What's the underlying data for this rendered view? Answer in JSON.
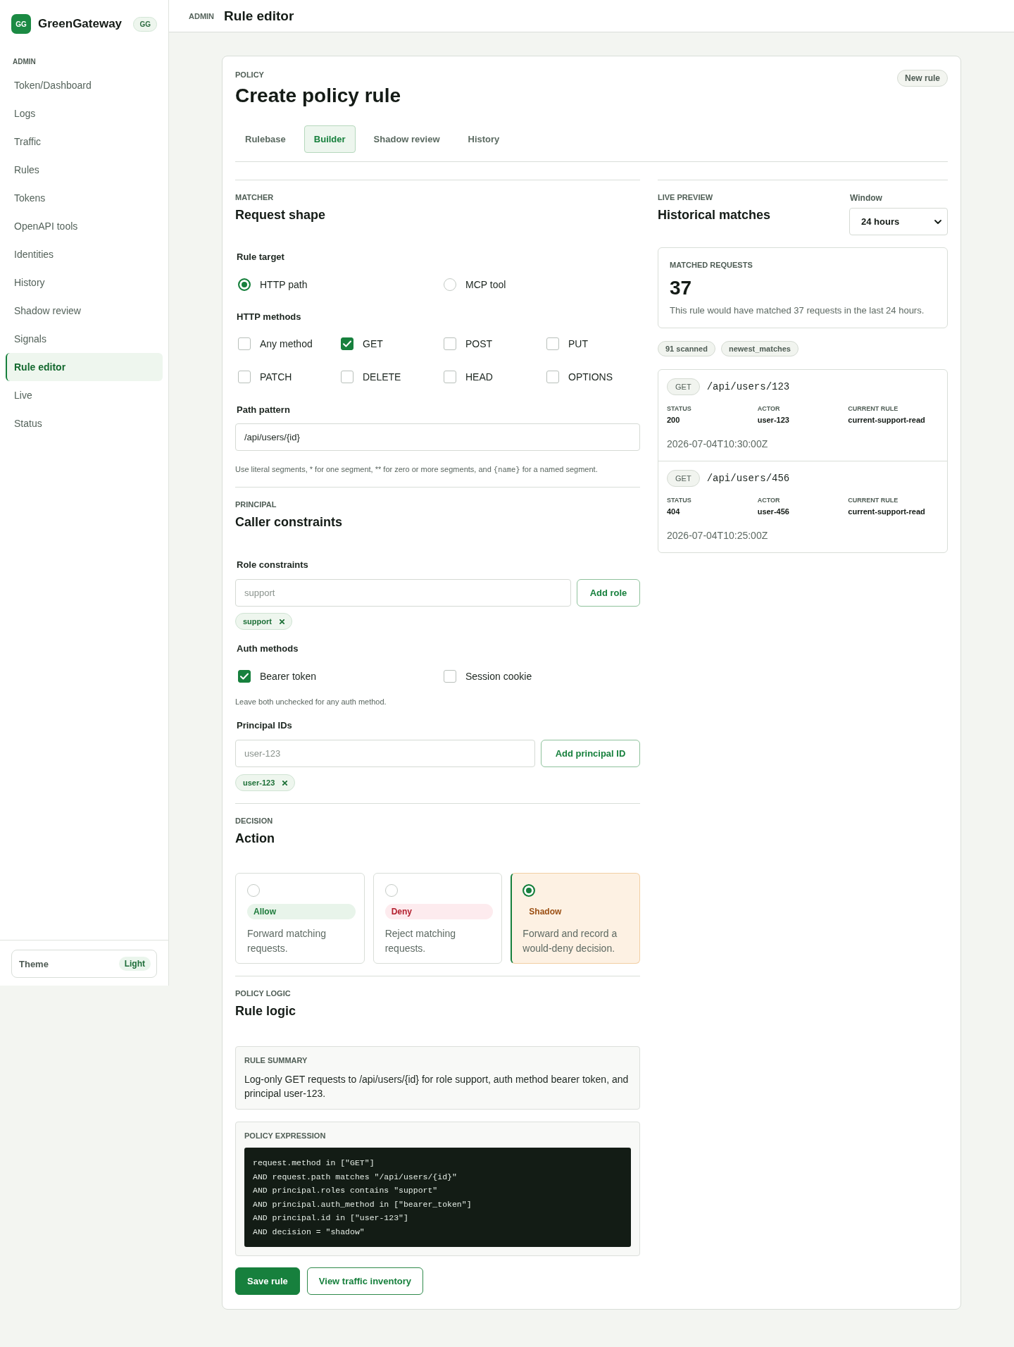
{
  "sidebar": {
    "brand": {
      "logo": "GG",
      "name": "GreenGateway",
      "badge": "GG"
    },
    "section": "ADMIN",
    "items": [
      {
        "label": "Token/Dashboard",
        "selected": false
      },
      {
        "label": "Logs",
        "selected": false
      },
      {
        "label": "Traffic",
        "selected": false
      },
      {
        "label": "Rules",
        "selected": false
      },
      {
        "label": "Tokens",
        "selected": false
      },
      {
        "label": "OpenAPI tools",
        "selected": false
      },
      {
        "label": "Identities",
        "selected": false
      },
      {
        "label": "History",
        "selected": false
      },
      {
        "label": "Shadow review",
        "selected": false
      },
      {
        "label": "Signals",
        "selected": false
      },
      {
        "label": "Rule editor",
        "selected": true
      },
      {
        "label": "Live",
        "selected": false
      },
      {
        "label": "Status",
        "selected": false
      }
    ],
    "theme": {
      "label": "Theme",
      "value": "Light"
    }
  },
  "header": {
    "section": "ADMIN",
    "title": "Rule editor"
  },
  "policy": {
    "eyebrow": "POLICY",
    "title": "Create policy rule",
    "badge": "New rule",
    "tabs": [
      {
        "label": "Rulebase",
        "selected": false
      },
      {
        "label": "Builder",
        "selected": true
      },
      {
        "label": "Shadow review",
        "selected": false
      },
      {
        "label": "History",
        "selected": false
      }
    ]
  },
  "matcher": {
    "eyebrow": "MATCHER",
    "title": "Request shape",
    "rule_target": {
      "label": "Rule target",
      "options": [
        {
          "label": "HTTP path",
          "selected": true
        },
        {
          "label": "MCP tool",
          "selected": false
        }
      ]
    },
    "http_methods": {
      "label": "HTTP methods",
      "options": [
        {
          "label": "Any method",
          "checked": false
        },
        {
          "label": "GET",
          "checked": true
        },
        {
          "label": "POST",
          "checked": false
        },
        {
          "label": "PUT",
          "checked": false
        },
        {
          "label": "PATCH",
          "checked": false
        },
        {
          "label": "DELETE",
          "checked": false
        },
        {
          "label": "HEAD",
          "checked": false
        },
        {
          "label": "OPTIONS",
          "checked": false
        }
      ]
    },
    "path_pattern": {
      "label": "Path pattern",
      "value": "/api/users/{id}",
      "help": [
        {
          "kind": "text",
          "text": "Use literal segments, * for one segment, ** for zero or more segments, and "
        },
        {
          "kind": "code",
          "text": "{name}"
        },
        {
          "kind": "text",
          "text": " for a named segment."
        }
      ]
    }
  },
  "principal": {
    "eyebrow": "PRINCIPAL",
    "title": "Caller constraints",
    "roles": {
      "label": "Role constraints",
      "placeholder": "support",
      "button": "Add role",
      "chips": [
        "support"
      ]
    },
    "auth_methods": {
      "label": "Auth methods",
      "options": [
        {
          "label": "Bearer token",
          "checked": true
        },
        {
          "label": "Session cookie",
          "checked": false
        }
      ],
      "help": "Leave both unchecked for any auth method."
    },
    "principal_ids": {
      "label": "Principal IDs",
      "placeholder": "user-123",
      "button": "Add principal ID",
      "chips": [
        "user-123"
      ]
    }
  },
  "decision": {
    "eyebrow": "DECISION",
    "title": "Action",
    "options": [
      {
        "kind": "allow",
        "label": "Allow",
        "description": "Forward matching requests.",
        "selected": false
      },
      {
        "kind": "deny",
        "label": "Deny",
        "description": "Reject matching requests.",
        "selected": false
      },
      {
        "kind": "shadow",
        "label": "Shadow",
        "description": "Forward and record a would-deny decision.",
        "selected": true
      }
    ]
  },
  "logic": {
    "eyebrow": "POLICY LOGIC",
    "title": "Rule logic",
    "summary": {
      "label": "RULE SUMMARY",
      "text": "Log-only GET requests to /api/users/{id} for role support, auth method bearer token, and principal user-123."
    },
    "expression": {
      "label": "POLICY EXPRESSION",
      "lines": [
        "request.method in [\"GET\"]",
        "AND request.path matches \"/api/users/{id}\"",
        "AND principal.roles contains \"support\"",
        "AND principal.auth_method in [\"bearer_token\"]",
        "AND principal.id in [\"user-123\"]",
        "AND decision = \"shadow\""
      ]
    }
  },
  "actions": [
    {
      "kind": "primary",
      "label": "Save rule"
    },
    {
      "kind": "secondary",
      "label": "View traffic inventory"
    }
  ],
  "preview": {
    "eyebrow": "LIVE PREVIEW",
    "title": "Historical matches",
    "window": {
      "label": "Window",
      "value": "24 hours"
    },
    "matched": {
      "label": "MATCHED REQUESTS",
      "count": "37",
      "text": "This rule would have matched 37 requests in the last 24 hours."
    },
    "chips": [
      "91 scanned",
      "newest_matches"
    ],
    "matches": [
      {
        "method": "GET",
        "path": "/api/users/123",
        "fields": [
          {
            "label": "STATUS",
            "value": "200"
          },
          {
            "label": "ACTOR",
            "value": "user-123"
          },
          {
            "label": "CURRENT RULE",
            "value": "current-support-read"
          }
        ],
        "time": "2026-07-04T10:30:00Z"
      },
      {
        "method": "GET",
        "path": "/api/users/456",
        "fields": [
          {
            "label": "STATUS",
            "value": "404"
          },
          {
            "label": "ACTOR",
            "value": "user-456"
          },
          {
            "label": "CURRENT RULE",
            "value": "current-support-read"
          }
        ],
        "time": "2026-07-04T10:25:00Z"
      }
    ]
  }
}
